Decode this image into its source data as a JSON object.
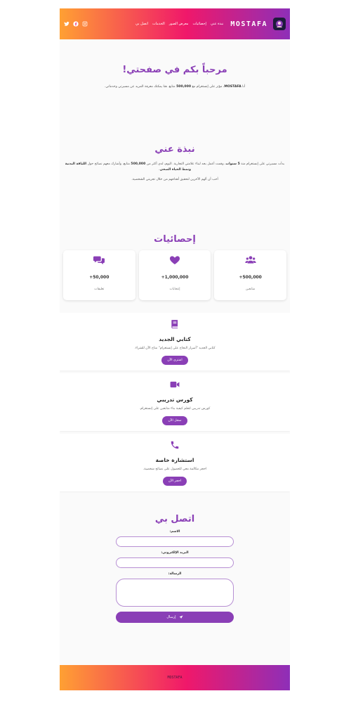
{
  "header": {
    "logo": "MOSTAFA",
    "nav": [
      "نبذة عني",
      "إحصائيات",
      "معرض الصور",
      "الخدمات",
      "اتصل بي"
    ],
    "social_icons": [
      "instagram-icon",
      "facebook-icon",
      "twitter-icon"
    ]
  },
  "hero": {
    "title": "مرحباً بكم في صفحتي!",
    "text_pre": "أنا ",
    "text_name": "MOSTAFA",
    "text_mid": "، مؤثر على إنستغرام مع ",
    "text_count": "500,000",
    "text_post": " متابع. هنا يمكنك معرفة المزيد عن مسيرتي وخدماتي."
  },
  "about": {
    "title": "نبذة عني",
    "p1_a": "بدأت مسيرتي على إنستغرام منذ ",
    "p1_b": "5 سنوات",
    "p1_c": "، وقمت أعمل بجد لبناء علامتي التجارية. اليوم، لدي أكثر من ",
    "p1_d": "500,000",
    "p1_e": " متابع، وأشارك معهم نصائح حول ",
    "p1_f": "اللياقة البدنية ونمط الحياة الصحي",
    "p1_g": ".",
    "p2": "أحب أن ألهم الآخرين لتحقيق أهدافهم من خلال تجربتي الشخصية."
  },
  "stats": {
    "title": "إحصائيات",
    "items": [
      {
        "icon": "users-icon",
        "value": "+500,000",
        "label": "متابعين"
      },
      {
        "icon": "heart-icon",
        "value": "+1,000,000",
        "label": "إعجابات"
      },
      {
        "icon": "comments-icon",
        "value": "+50,000",
        "label": "تعليقات"
      }
    ]
  },
  "offers": [
    {
      "icon": "book-icon",
      "title": "كتابي الجديد",
      "text": "كتابي الجديد \"أسرار النجاح على إنستغرام\" متاح الآن للشراء.",
      "button": "اشتري الآن"
    },
    {
      "icon": "video-icon",
      "title": "كورس تدريبي",
      "text": "كورس تدريبي لتعلم كيفية بناء متابعين على إنستغرام.",
      "button": "سجل الآن"
    },
    {
      "icon": "phone-icon",
      "title": "استشارة خاصة",
      "text": "احجز مكالمة معي للحصول على نصائح شخصية.",
      "button": "احجز الآن"
    }
  ],
  "contact": {
    "title": "اتصل بي",
    "name_label": "الاسم:",
    "email_label": "البريد الإلكتروني:",
    "message_label": "الرسالة:",
    "send_label": "إرسال"
  },
  "footer": {
    "text": "MOSTAFA"
  },
  "colors": {
    "accent": "#8a3fb6",
    "gradient_start": "#ffa033",
    "gradient_mid": "#f0186a",
    "gradient_end": "#8e2fb8"
  }
}
